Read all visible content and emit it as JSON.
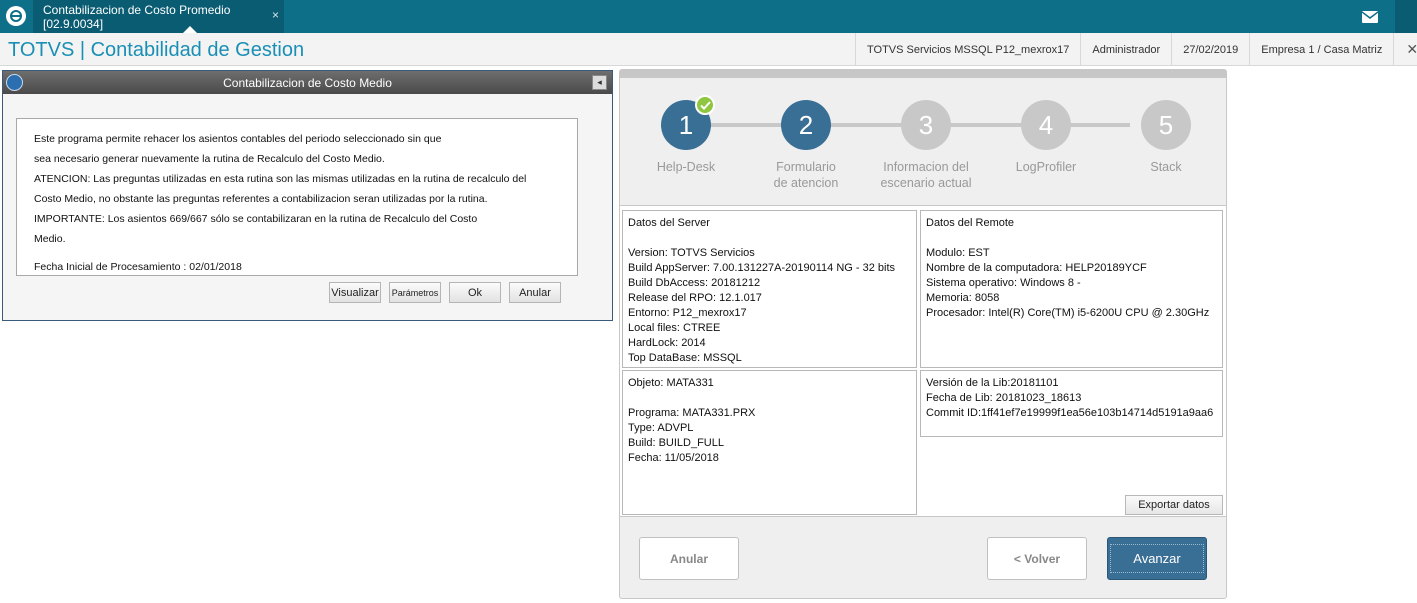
{
  "topbar": {
    "tab_label": "Contabilizacion de Costo Promedio [02.9.0034]",
    "tab_close": "×"
  },
  "header": {
    "app_title": "TOTVS | Contabilidad de Gestion",
    "environment": "TOTVS Servicios MSSQL P12_mexrox17",
    "user": "Administrador",
    "date": "27/02/2019",
    "company": "Empresa 1 / Casa Matriz",
    "exit_label": "Ex"
  },
  "dialog": {
    "title": "Contabilizacion de Costo Medio",
    "collapse": "◂",
    "lines": [
      "Este programa permite rehacer los asientos contables del periodo seleccionado sin que",
      "sea necesario generar nuevamente la rutina de Recalculo del Costo Medio.",
      "ATENCION: Las preguntas utilizadas en esta rutina son las mismas utilizadas en la rutina de recalculo del",
      "Costo Medio, no obstante las preguntas referentes a contabilizacion seran utilizadas por la rutina.",
      "IMPORTANTE: Los asientos 669/667 sólo se contabilizaran en la rutina de Recalculo del Costo",
      "Medio."
    ],
    "fecha": "Fecha Inicial de Procesamiento : 02/01/2018",
    "buttons": {
      "visualizar": "Visualizar",
      "parametros": "Parámetros",
      "ok": "Ok",
      "anular": "Anular"
    }
  },
  "wizard": {
    "steps": [
      {
        "number": "1",
        "label": "Help-Desk",
        "state": "done"
      },
      {
        "number": "2",
        "label": "Formulario de atencion",
        "state": "active"
      },
      {
        "number": "3",
        "label": "Informacion del escenario actual",
        "state": "pending"
      },
      {
        "number": "4",
        "label": "LogProfiler",
        "state": "pending"
      },
      {
        "number": "5",
        "label": "Stack",
        "state": "pending"
      }
    ],
    "server": {
      "title": "Datos del Server",
      "lines": [
        "Version: TOTVS Servicios",
        "Build AppServer: 7.00.131227A-20190114 NG - 32 bits",
        "Build DbAccess: 20181212",
        "Release del RPO:  12.1.017",
        "Entorno: P12_mexrox17",
        "Local files: CTREE",
        "HardLock: 2014",
        "Top DataBase: MSSQL"
      ]
    },
    "remote": {
      "title": "Datos del Remote",
      "lines": [
        "Modulo: EST",
        "Nombre de la computadora: HELP20189YCF",
        "Sistema operativo: Windows 8 -",
        "Memoria: 8058",
        "Procesador: Intel(R) Core(TM) i5-6200U CPU @ 2.30GHz"
      ]
    },
    "object": {
      "title": "Objeto: MATA331",
      "lines": [
        "Programa: MATA331.PRX",
        "Type: ADVPL",
        "Build: BUILD_FULL",
        "Fecha: 11/05/2018"
      ]
    },
    "lib": {
      "lines": [
        "Versión de la Lib:20181101",
        "Fecha de Lib: 20181023_18613",
        "Commit ID:1ff41ef7e19999f1ea56e103b14714d5191a9aa6"
      ]
    },
    "export_label": "Exportar datos",
    "anular_label": "Anular",
    "volver_label": "< Volver",
    "avanzar_label": "Avanzar"
  },
  "colors": {
    "topbar": "#0d6f88",
    "accent_title": "#1a8fb5",
    "step_active": "#3a6f95",
    "step_inactive": "#c8c8c8",
    "check": "#8fc63f"
  }
}
